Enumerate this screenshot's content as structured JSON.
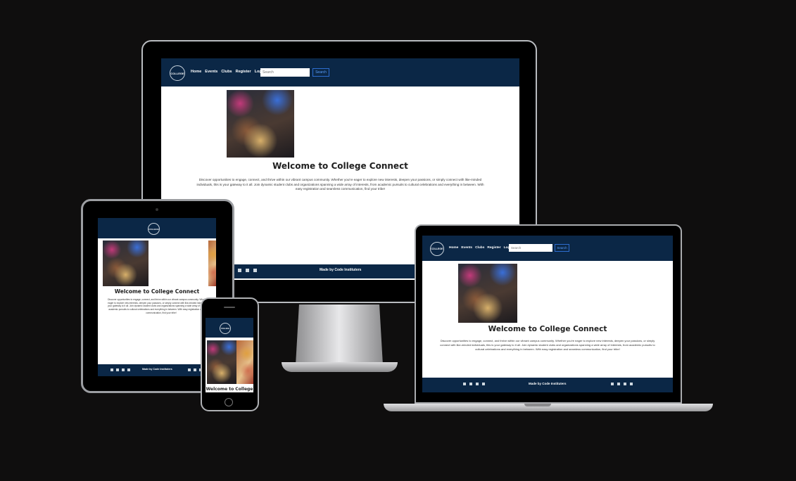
{
  "site": {
    "logo_text": "COLLEGE",
    "nav": [
      "Home",
      "Events",
      "Clubs",
      "Register",
      "Login"
    ],
    "search": {
      "placeholder": "Search",
      "button": "Search"
    },
    "heading": "Welcome to College Connect",
    "heading_short": "Welcome to College",
    "paragraph": "Discover opportunities to engage, connect, and thrive within our vibrant campus community. Whether you're eager to explore new interests, deepen your passions, or simply connect with like-minded individuals, this is your gateway to it all. Join dynamic student clubs and organizations spanning a wide array of interests, from academic pursuits to cultural celebrations and everything in between. With easy registration and seamless communication, find your tribe!",
    "footer_text": "Made by Code Instituters"
  },
  "colors": {
    "background": "#0f0e0e",
    "navbar": "#0b2746",
    "search_button": "#2d6dcf"
  }
}
